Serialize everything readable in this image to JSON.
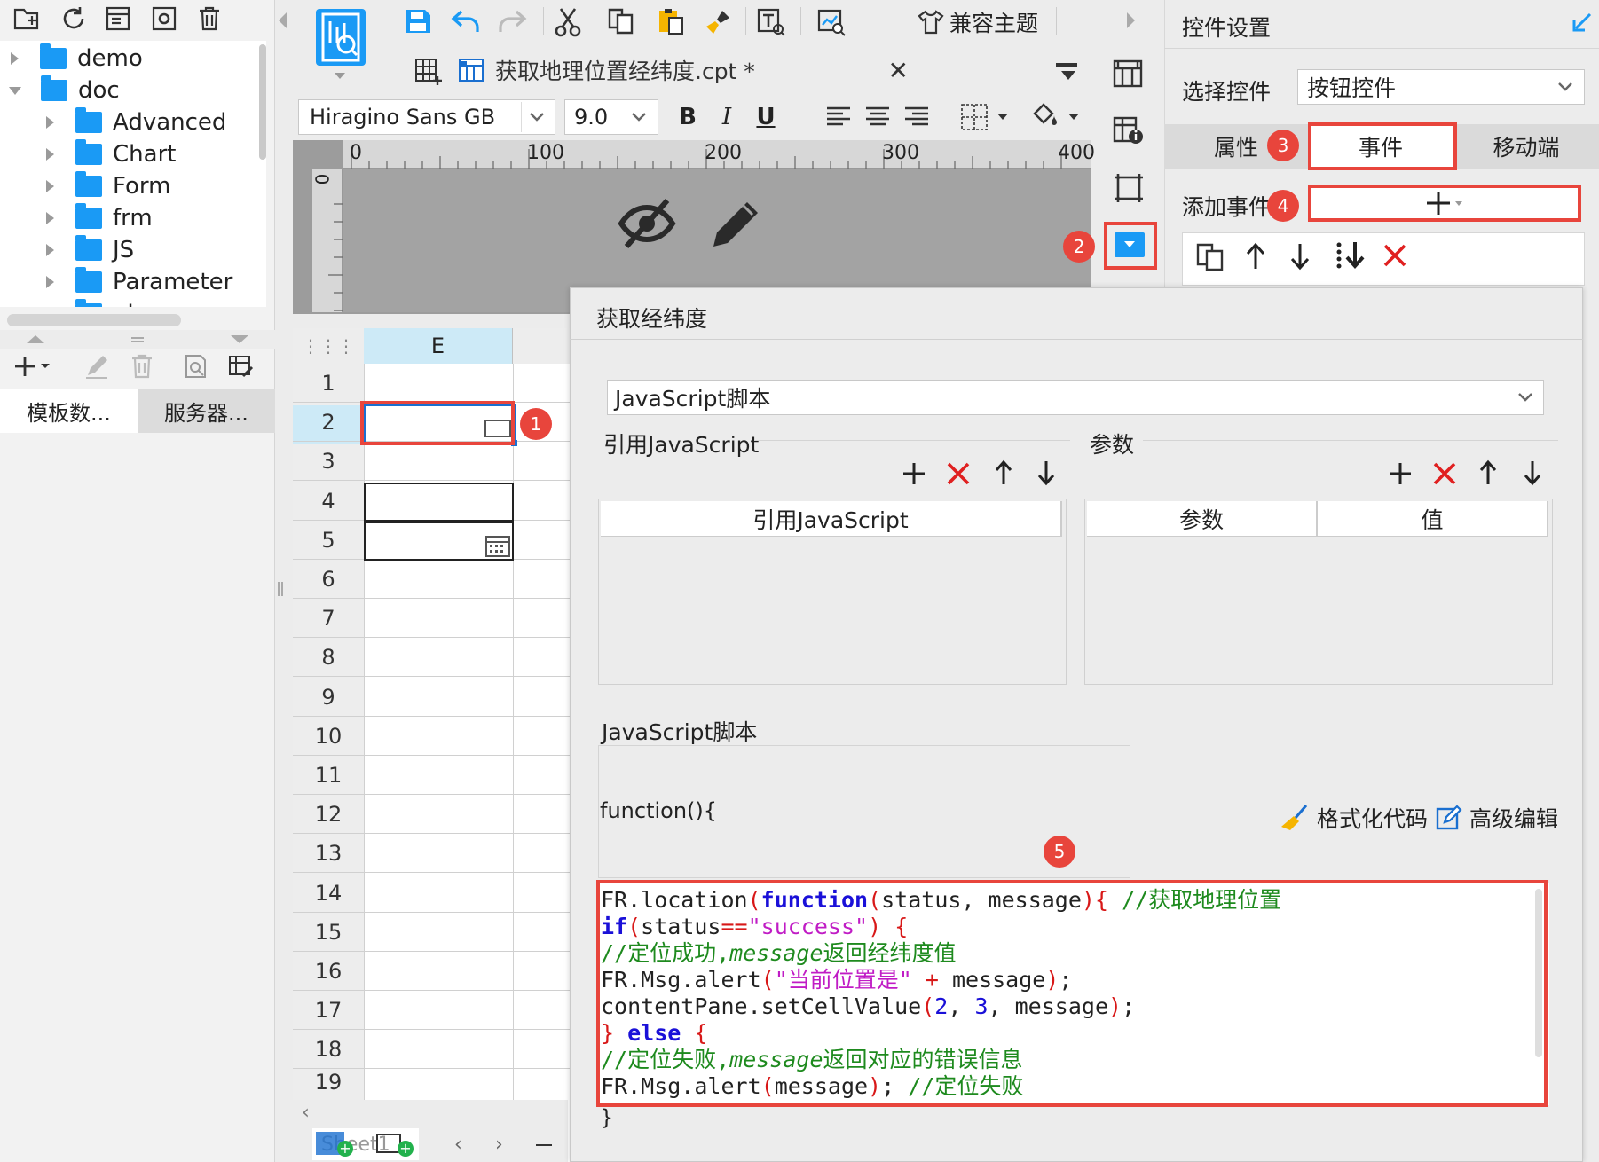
{
  "left_panel": {
    "tree": [
      {
        "label": "demo",
        "expanded": false
      },
      {
        "label": "doc",
        "expanded": true
      },
      {
        "label": "Advanced"
      },
      {
        "label": "Chart"
      },
      {
        "label": "Form"
      },
      {
        "label": "frm"
      },
      {
        "label": "JS"
      },
      {
        "label": "Parameter"
      },
      {
        "label": "phone"
      }
    ],
    "tabs": [
      "模板数...",
      "服务器..."
    ]
  },
  "editor": {
    "file_tab": "获取地理位置经纬度.cpt *",
    "theme_button": "兼容主题",
    "font_family": "Hiragino Sans GB",
    "font_size": "9.0",
    "bold": "B",
    "italic": "I",
    "underline": "U",
    "ruler": {
      "zero": "0",
      "labels": [
        "100",
        "200",
        "300",
        "400"
      ]
    },
    "column_header": "E",
    "row_numbers": [
      "1",
      "2",
      "3",
      "4",
      "5",
      "6",
      "7",
      "8",
      "9",
      "10",
      "11",
      "12",
      "13",
      "14",
      "15",
      "16",
      "17",
      "18",
      "19"
    ],
    "sheet_tab": "Sheet1"
  },
  "right_panel": {
    "title": "控件设置",
    "select_widget_label": "选择控件",
    "select_widget_value": "按钮控件",
    "tabs": [
      "属性",
      "事件",
      "移动端"
    ],
    "active_tab": "事件",
    "add_event_label": "添加事件"
  },
  "dialog": {
    "title": "获取经纬度",
    "script_type": "JavaScript脚本",
    "ref_js_label": "引用JavaScript",
    "params_label": "参数",
    "ref_js_column": "引用JavaScript",
    "param_columns": [
      "参数",
      "值"
    ],
    "script_section_label": "JavaScript脚本",
    "function_header": "function(){",
    "format_code": "格式化代码",
    "advanced_edit": "高级编辑",
    "closing_brace": "}"
  },
  "badges": [
    "1",
    "2",
    "3",
    "4",
    "5"
  ],
  "colors": {
    "accent": "#1a9af5",
    "highlight": "#e8453c",
    "active_tab": "#ffffff",
    "column_highlight": "#cdeaf7"
  }
}
